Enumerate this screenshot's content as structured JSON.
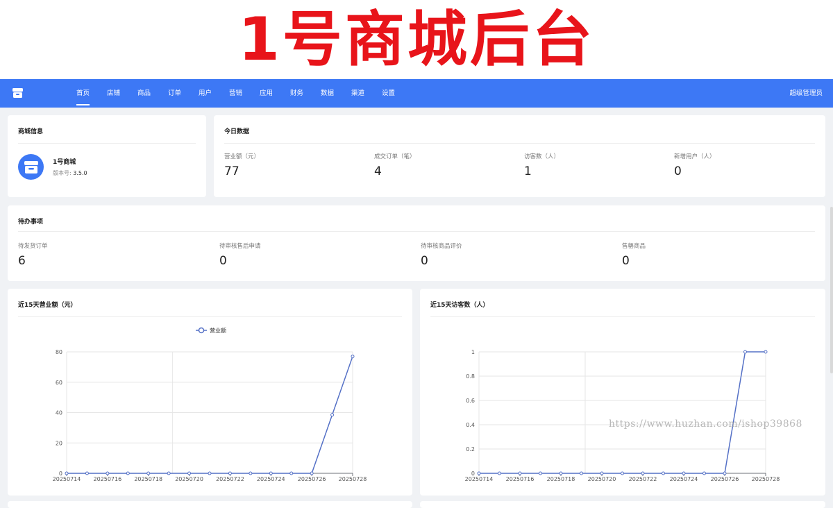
{
  "banner": {
    "text": "1号商城后台"
  },
  "nav": {
    "items": [
      "首页",
      "店铺",
      "商品",
      "订单",
      "用户",
      "营销",
      "应用",
      "财务",
      "数据",
      "渠道",
      "设置"
    ],
    "active_index": 0,
    "user": "超级管理员"
  },
  "shop_info": {
    "title": "商城信息",
    "name": "1号商城",
    "version_label": "版本号:",
    "version": "3.5.0"
  },
  "today": {
    "title": "今日数据",
    "stats": [
      {
        "label": "营业额（元）",
        "value": "77"
      },
      {
        "label": "成交订单（笔）",
        "value": "4"
      },
      {
        "label": "访客数（人）",
        "value": "1"
      },
      {
        "label": "新增用户（人）",
        "value": "0"
      }
    ]
  },
  "todo": {
    "title": "待办事项",
    "items": [
      {
        "label": "待发货订单",
        "value": "6"
      },
      {
        "label": "待审核售后申请",
        "value": "0"
      },
      {
        "label": "待审核商品评价",
        "value": "0"
      },
      {
        "label": "售罄商品",
        "value": "0"
      }
    ]
  },
  "chart_data": [
    {
      "type": "line",
      "title": "近15天营业额（元）",
      "legend": "营业额",
      "legend_position": "top-center",
      "x": [
        "20250714",
        "20250715",
        "20250716",
        "20250717",
        "20250718",
        "20250719",
        "20250720",
        "20250721",
        "20250722",
        "20250723",
        "20250724",
        "20250725",
        "20250726",
        "20250727",
        "20250728"
      ],
      "x_tick_labels": [
        "20250714",
        "20250716",
        "20250718",
        "20250720",
        "20250722",
        "20250724",
        "20250726",
        "20250728"
      ],
      "series": [
        {
          "name": "营业额",
          "values": [
            0,
            0,
            0,
            0,
            0,
            0,
            0,
            0,
            0,
            0,
            0,
            0,
            0,
            38.5,
            77
          ]
        }
      ],
      "ylim": [
        0,
        80
      ],
      "y_ticks": [
        "0",
        "20",
        "40",
        "60",
        "80"
      ],
      "color": "#5470c6",
      "grid": true
    },
    {
      "type": "line",
      "title": "近15天访客数（人）",
      "x": [
        "20250714",
        "20250715",
        "20250716",
        "20250717",
        "20250718",
        "20250719",
        "20250720",
        "20250721",
        "20250722",
        "20250723",
        "20250724",
        "20250725",
        "20250726",
        "20250727",
        "20250728"
      ],
      "x_tick_labels": [
        "20250714",
        "20250716",
        "20250718",
        "20250720",
        "20250722",
        "20250724",
        "20250726",
        "20250728"
      ],
      "series": [
        {
          "values": [
            0,
            0,
            0,
            0,
            0,
            0,
            0,
            0,
            0,
            0,
            0,
            0,
            0,
            1,
            1
          ]
        }
      ],
      "ylim": [
        0,
        1
      ],
      "y_ticks": [
        "0",
        "0.2",
        "0.4",
        "0.6",
        "0.8",
        "1"
      ],
      "color": "#5470c6",
      "grid": true
    }
  ],
  "watermark": "https://www.huzhan.com/ishop39868"
}
